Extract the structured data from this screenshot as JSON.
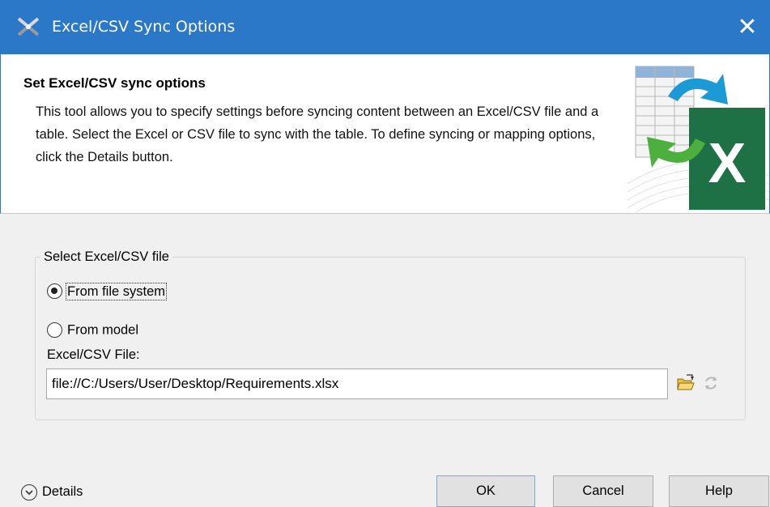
{
  "window": {
    "title": "Excel/CSV Sync Options",
    "close_glyph": "✕"
  },
  "header": {
    "title": "Set Excel/CSV sync options",
    "description": "This tool allows you to specify settings before syncing content between an Excel/CSV file and a table. Select the Excel or CSV file to sync with the table. To define syncing or mapping options, click the Details button."
  },
  "group": {
    "legend": "Select Excel/CSV file",
    "options": [
      {
        "label": "From file system",
        "selected": true
      },
      {
        "label": "From model",
        "selected": false
      }
    ],
    "file_label": "Excel/CSV File:",
    "file_value": "file://C:/Users/User/Desktop/Requirements.xlsx"
  },
  "footer": {
    "details_label": "Details",
    "ok_label": "OK",
    "cancel_label": "Cancel",
    "help_label": "Help"
  },
  "icons": {
    "app": "magicdraw-app-icon",
    "excel": "excel-sync-illustration",
    "folder": "folder-open-icon",
    "sync": "sync-icon",
    "details": "chevron-down-circle-icon"
  },
  "colors": {
    "titlebar": "#2b78c8",
    "excel_green": "#1e7145"
  }
}
